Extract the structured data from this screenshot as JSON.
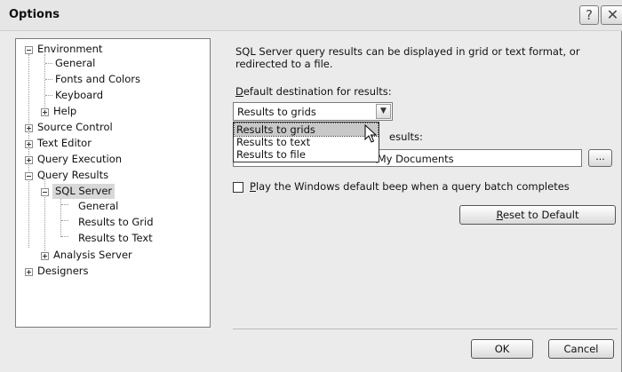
{
  "window": {
    "title": "Options",
    "help_label": "?",
    "close_label": "✕"
  },
  "tree": {
    "environment": "Environment",
    "env_general": "General",
    "env_fonts": "Fonts and Colors",
    "env_keyboard": "Keyboard",
    "env_help": "Help",
    "source_control": "Source Control",
    "text_editor": "Text Editor",
    "query_execution": "Query Execution",
    "query_results": "Query Results",
    "sql_server": "SQL Server",
    "sql_general": "General",
    "results_grid": "Results to Grid",
    "results_text": "Results to Text",
    "analysis_server": "Analysis Server",
    "designers": "Designers"
  },
  "panel": {
    "description": "SQL Server query results can be displayed in grid or text format, or redirected to a file.",
    "dest_label_accel": "D",
    "dest_label_rest": "efault destination for results:",
    "dest_selected": "Results to grids",
    "dest_options": [
      "Results to grids",
      "Results to text",
      "Results to file"
    ],
    "results_label_partial": "esults:",
    "path_value_partial": "ew Watt\\My Documents",
    "browse_label": "...",
    "beep_accel": "P",
    "beep_rest": "lay the Windows default beep when a query batch completes",
    "reset_accel": "R",
    "reset_rest": "eset to Default",
    "ok_label": "OK",
    "cancel_label": "Cancel"
  },
  "colors": {
    "window_bg": "#ebebeb",
    "selection": "#c8c8c8"
  },
  "icons": {
    "pointer": "arrow-cursor-icon",
    "dropdown": "chevron-down-icon"
  }
}
